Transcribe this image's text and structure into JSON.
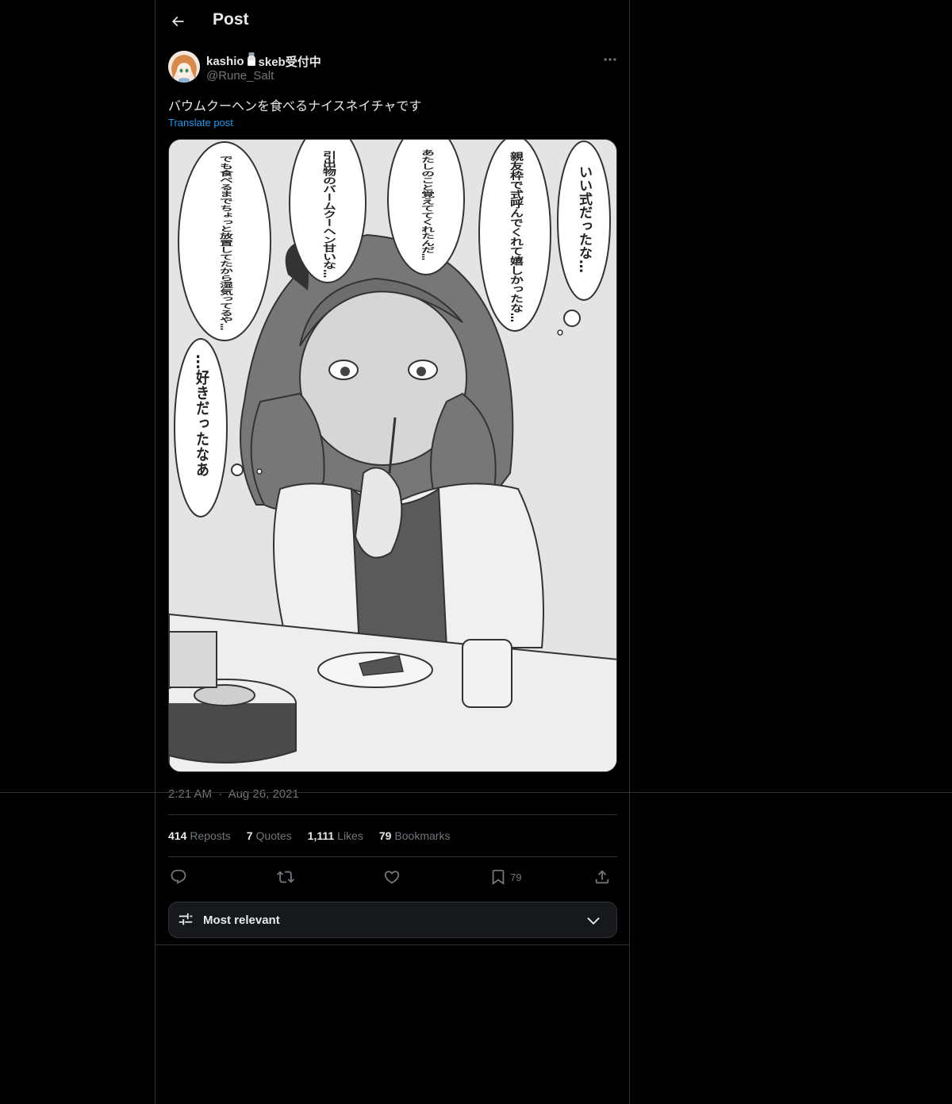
{
  "header": {
    "title": "Post",
    "back_icon": "arrow-left-icon"
  },
  "author": {
    "name_part1": "kashio",
    "name_part2": "skeb受付中",
    "name_emoji": "salt-shaker-emoji",
    "handle": "@Rune_Salt"
  },
  "post": {
    "text": "バウムクーヘンを食べるナイスネイチャです",
    "translate_label": "Translate post",
    "time": "2:21 AM",
    "separator": "·",
    "date": "Aug 26, 2021"
  },
  "media": {
    "bubbles": [
      "いい式だったな…",
      "親友枠で式呼んでくれて嬉しかったな…",
      "あたしのこと覚えててくれたんだ…",
      "引出物のバームクーヘン甘いな…",
      "でも食べるまでちょっと放置してたから湿気ってるや…",
      "…好きだったなあ"
    ]
  },
  "stats": {
    "reposts_count": "414",
    "reposts_label": "Reposts",
    "quotes_count": "7",
    "quotes_label": "Quotes",
    "likes_count": "1,111",
    "likes_label": "Likes",
    "bookmarks_count": "79",
    "bookmarks_label": "Bookmarks"
  },
  "actions": {
    "reply_icon": "reply-icon",
    "repost_icon": "repost-icon",
    "like_icon": "heart-icon",
    "bookmark_icon": "bookmark-icon",
    "bookmark_count": "79",
    "share_icon": "share-icon"
  },
  "sort": {
    "label": "Most relevant",
    "icon": "sliders-icon",
    "chevron": "chevron-down-icon"
  },
  "colors": {
    "background": "#000000",
    "border": "#2f3336",
    "text_primary": "#e7e9ea",
    "text_secondary": "#71767b",
    "link": "#1d9bf0",
    "sort_bg": "#16181c"
  }
}
